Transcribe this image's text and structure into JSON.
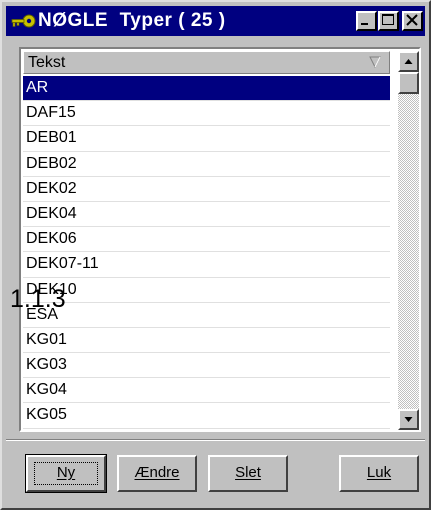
{
  "window": {
    "title": "NØGLE  Typer ( 25 )",
    "icon": "key-icon"
  },
  "list": {
    "column_header": "Tekst",
    "items": [
      "AR",
      "DAF15",
      "DEB01",
      "DEB02",
      "DEK02",
      "DEK04",
      "DEK06",
      "DEK07-11",
      "DEK10",
      "ESA",
      "KG01",
      "KG03",
      "KG04",
      "KG05"
    ],
    "selected_index": 0
  },
  "overlay_label": "1.1.3",
  "buttons": {
    "ny": "Ny",
    "aendre": "Ændre",
    "slet": "Slet",
    "luk": "Luk"
  },
  "colors": {
    "titlebar": "#000080",
    "selection": "#000080",
    "face": "#c0c0c0"
  }
}
